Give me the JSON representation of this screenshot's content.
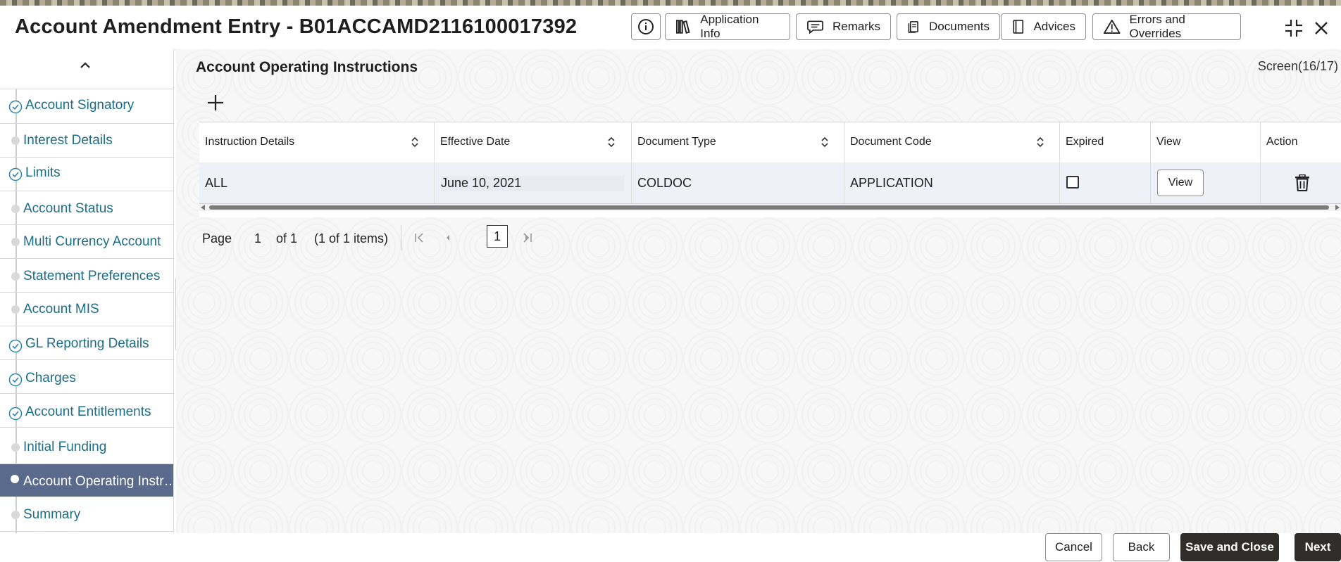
{
  "header": {
    "title": "Account Amendment Entry - B01ACCAMD2116100017392",
    "buttons": {
      "application_info": "Application Info",
      "remarks": "Remarks",
      "documents": "Documents",
      "advices": "Advices",
      "errors_overrides": "Errors and Overrides"
    }
  },
  "sidebar": {
    "items": [
      {
        "label": "Account Signatory",
        "state": "done"
      },
      {
        "label": "Interest Details",
        "state": "pending"
      },
      {
        "label": "Limits",
        "state": "done"
      },
      {
        "label": "Account Status",
        "state": "pending"
      },
      {
        "label": "Multi Currency Account",
        "state": "pending"
      },
      {
        "label": "Statement Preferences",
        "state": "pending"
      },
      {
        "label": "Account MIS",
        "state": "pending"
      },
      {
        "label": "GL Reporting Details",
        "state": "done"
      },
      {
        "label": "Charges",
        "state": "done"
      },
      {
        "label": "Account Entitlements",
        "state": "done"
      },
      {
        "label": "Initial Funding",
        "state": "pending"
      },
      {
        "label": "Account Operating Instr…",
        "state": "active"
      },
      {
        "label": "Summary",
        "state": "pending"
      }
    ]
  },
  "main": {
    "section_title": "Account Operating Instructions",
    "screen_counter": "Screen(16/17)",
    "table": {
      "columns": [
        "Instruction Details",
        "Effective Date",
        "Document Type",
        "Document Code",
        "Expired",
        "View",
        "Action"
      ],
      "rows": [
        {
          "instruction_details": "ALL",
          "effective_date": "June 10, 2021",
          "document_type": "COLDOC",
          "document_code": "APPLICATION",
          "expired": false,
          "view_label": "View"
        }
      ]
    },
    "pagination": {
      "page_label": "Page",
      "page_value": "1",
      "of_label": "of 1",
      "items_label": "(1 of 1 items)",
      "current": "1"
    }
  },
  "footer": {
    "cancel": "Cancel",
    "back": "Back",
    "save_close": "Save and Close",
    "next": "Next"
  },
  "colors": {
    "accent_text": "#1c6d88",
    "active_nav_bg": "#5a6a8c",
    "primary_button": "#312d2a",
    "row_highlight": "#eff1f9"
  }
}
